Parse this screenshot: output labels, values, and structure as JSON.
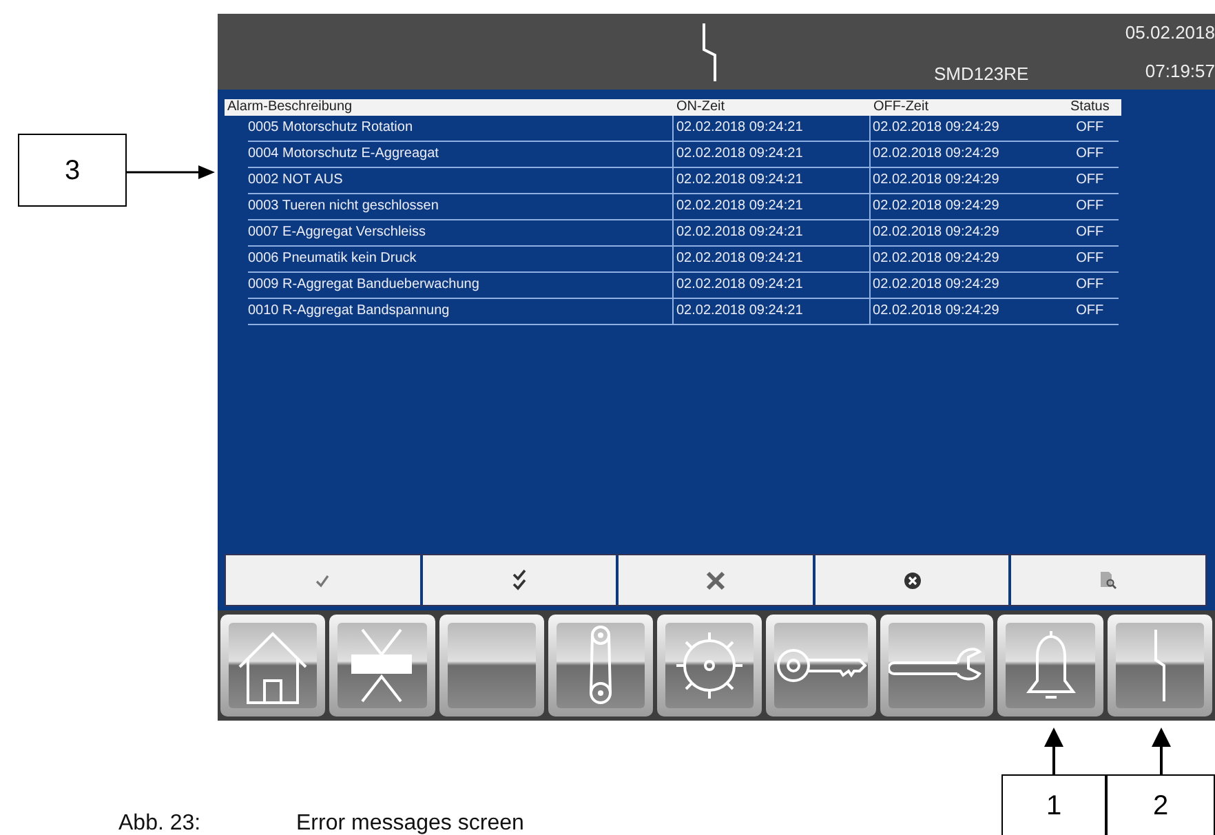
{
  "header": {
    "device": "SMD123RE",
    "date": "05.02.2018",
    "time": "07:19:57"
  },
  "table": {
    "columns": [
      "Alarm-Beschreibung",
      "ON-Zeit",
      "OFF-Zeit",
      "Status"
    ],
    "rows": [
      {
        "description": "0005 Motorschutz Rotation",
        "on_time": "02.02.2018 09:24:21",
        "off_time": "02.02.2018 09:24:29",
        "status": "OFF"
      },
      {
        "description": "0004 Motorschutz E-Aggreagat",
        "on_time": "02.02.2018 09:24:21",
        "off_time": "02.02.2018 09:24:29",
        "status": "OFF"
      },
      {
        "description": "0002 NOT AUS",
        "on_time": "02.02.2018 09:24:21",
        "off_time": "02.02.2018 09:24:29",
        "status": "OFF"
      },
      {
        "description": "0003 Tueren nicht geschlossen",
        "on_time": "02.02.2018 09:24:21",
        "off_time": "02.02.2018 09:24:29",
        "status": "OFF"
      },
      {
        "description": "0007 E-Aggregat Verschleiss",
        "on_time": "02.02.2018 09:24:21",
        "off_time": "02.02.2018 09:24:29",
        "status": "OFF"
      },
      {
        "description": "0006 Pneumatik kein Druck",
        "on_time": "02.02.2018 09:24:21",
        "off_time": "02.02.2018 09:24:29",
        "status": "OFF"
      },
      {
        "description": "0009 R-Aggregat Bandueberwachung",
        "on_time": "02.02.2018 09:24:21",
        "off_time": "02.02.2018 09:24:29",
        "status": "OFF"
      },
      {
        "description": "0010 R-Aggregat Bandspannung",
        "on_time": "02.02.2018 09:24:21",
        "off_time": "02.02.2018 09:24:29",
        "status": "OFF"
      }
    ]
  },
  "callouts": [
    {
      "label": "3"
    },
    {
      "label": "1"
    },
    {
      "label": "2"
    }
  ],
  "caption": {
    "number": "Abb. 23:",
    "title": "Error messages screen"
  }
}
